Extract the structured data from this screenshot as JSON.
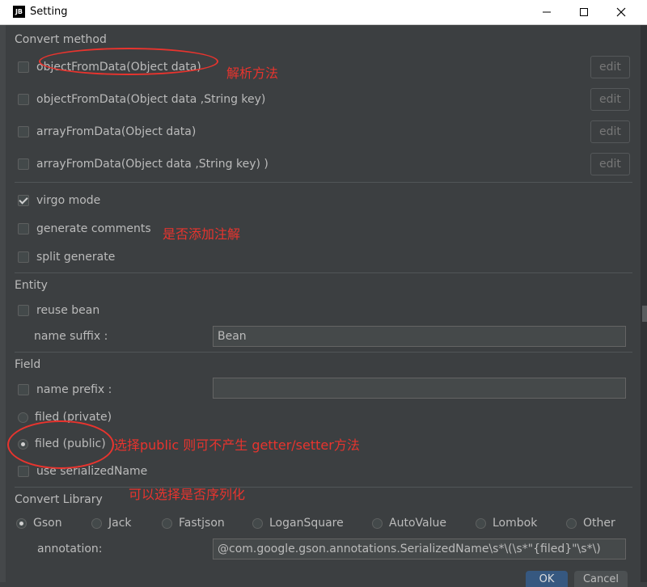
{
  "window": {
    "title": "Setting",
    "logo_text": "JB"
  },
  "convert_method": {
    "title": "Convert method",
    "methods": [
      {
        "label": "objectFromData(Object data)",
        "checked": false,
        "edit_label": "edit"
      },
      {
        "label": "objectFromData(Object data ,String key)",
        "checked": false,
        "edit_label": "edit"
      },
      {
        "label": "arrayFromData(Object data)",
        "checked": false,
        "edit_label": "edit"
      },
      {
        "label": "arrayFromData(Object data ,String key) )",
        "checked": false,
        "edit_label": "edit"
      }
    ],
    "options": [
      {
        "label": "virgo mode",
        "checked": true
      },
      {
        "label": "generate comments",
        "checked": false
      },
      {
        "label": "split generate",
        "checked": false
      }
    ]
  },
  "entity": {
    "title": "Entity",
    "reuse_bean_label": "reuse bean",
    "reuse_bean_checked": false,
    "name_suffix_label": "name suffix :",
    "name_suffix_value": "Bean"
  },
  "field": {
    "title": "Field",
    "name_prefix_label": "name prefix :",
    "name_prefix_checked": false,
    "name_prefix_value": "",
    "private_label": "filed (private)",
    "public_label": "filed (public)",
    "selected": "public",
    "serialized_label": "use serializedName",
    "serialized_checked": false
  },
  "convert_library": {
    "title": "Convert Library",
    "options": [
      "Gson",
      "Jack",
      "Fastjson",
      "LoganSquare",
      "AutoValue",
      "Lombok",
      "Other"
    ],
    "selected": "Gson",
    "annotation_label": "annotation:",
    "annotation_value": "@com.google.gson.annotations.SerializedName\\s*\\(\\s*\"{filed}\"\\s*\\)"
  },
  "annotations": {
    "parse_method": "解析方法",
    "add_comments": "是否添加注解",
    "select_public": "选择public   则可不产生 getter/setter方法",
    "serialize_choice": "可以选择是否序列化"
  },
  "footer": {
    "ok_label": "OK",
    "cancel_label": "Cancel"
  },
  "colors": {
    "annotation": "#e8342e",
    "dialog_bg": "#3c3f41",
    "primary_button": "#365880"
  }
}
